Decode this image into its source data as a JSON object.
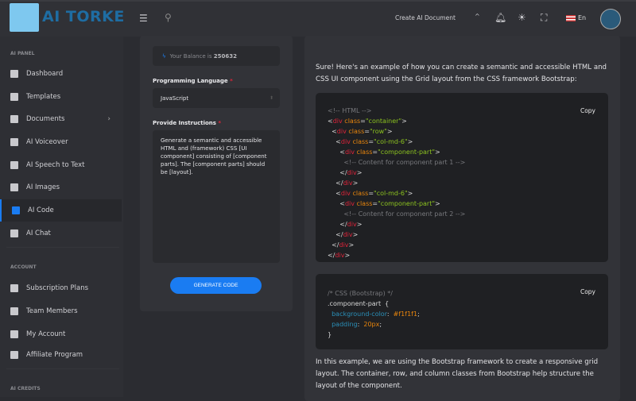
{
  "header": {
    "brand": "AI TORKE",
    "create_label": "Create AI Document",
    "lang": "En",
    "icons": [
      "menu-icon",
      "search-icon",
      "chevron-up-icon",
      "bell-icon",
      "sun-icon",
      "fullscreen-icon",
      "us-flag-icon",
      "avatar"
    ]
  },
  "sidebar": {
    "sections": [
      "AI PANEL",
      "ACCOUNT",
      "AI CREDITS"
    ],
    "items": [
      {
        "label": "Dashboard",
        "icon": "dashboard-icon"
      },
      {
        "label": "Templates",
        "icon": "templates-icon"
      },
      {
        "label": "Documents",
        "icon": "folder-icon"
      },
      {
        "label": "AI Voiceover",
        "icon": "waveform-icon"
      },
      {
        "label": "AI Speech to Text",
        "icon": "audio-file-icon"
      },
      {
        "label": "AI Images",
        "icon": "image-icon"
      },
      {
        "label": "AI Code",
        "icon": "code-icon"
      },
      {
        "label": "AI Chat",
        "icon": "chat-icon"
      },
      {
        "label": "Subscription Plans",
        "icon": "plans-icon"
      },
      {
        "label": "Team Members",
        "icon": "team-icon"
      },
      {
        "label": "My Account",
        "icon": "account-icon"
      },
      {
        "label": "Affiliate Program",
        "icon": "dollar-icon"
      }
    ]
  },
  "form": {
    "balance_prefix": "Your Balance is",
    "balance": "250632",
    "language_label": "Programming Language",
    "language_value": "JavaScript",
    "instructions_label": "Provide Instructions",
    "instructions_value": "Generate a semantic and accessible HTML and (framework) CSS [UI component] consisting of [component parts]. The [component parts] should be [layout].",
    "generate_label": "GENERATE CODE"
  },
  "result": {
    "intro": "Sure! Here's an example of how you can create a semantic and accessible HTML and CSS UI component using the Grid layout from the CSS framework Bootstrap:",
    "copy_label": "Copy",
    "html_code": [
      [
        [
          "c",
          "<!-- HTML -->"
        ]
      ],
      [
        [
          "p",
          "<"
        ],
        [
          "tag",
          "div"
        ],
        [
          "attr",
          " class"
        ],
        [
          "p",
          "="
        ],
        [
          "str",
          "\"container\""
        ],
        [
          "p",
          ">"
        ]
      ],
      [
        [
          "p",
          "  <"
        ],
        [
          "tag",
          "div"
        ],
        [
          "attr",
          " class"
        ],
        [
          "p",
          "="
        ],
        [
          "str",
          "\"row\""
        ],
        [
          "p",
          ">"
        ]
      ],
      [
        [
          "p",
          "    <"
        ],
        [
          "tag",
          "div"
        ],
        [
          "attr",
          " class"
        ],
        [
          "p",
          "="
        ],
        [
          "str",
          "\"col-md-6\""
        ],
        [
          "p",
          ">"
        ]
      ],
      [
        [
          "p",
          "      <"
        ],
        [
          "tag",
          "div"
        ],
        [
          "attr",
          " class"
        ],
        [
          "p",
          "="
        ],
        [
          "str",
          "\"component-part\""
        ],
        [
          "p",
          ">"
        ]
      ],
      [
        [
          "c",
          "        <!-- Content for component part 1 -->"
        ]
      ],
      [
        [
          "p",
          "      </"
        ],
        [
          "tag",
          "div"
        ],
        [
          "p",
          ">"
        ]
      ],
      [
        [
          "p",
          "    </"
        ],
        [
          "tag",
          "div"
        ],
        [
          "p",
          ">"
        ]
      ],
      [
        [
          "p",
          "    <"
        ],
        [
          "tag",
          "div"
        ],
        [
          "attr",
          " class"
        ],
        [
          "p",
          "="
        ],
        [
          "str",
          "\"col-md-6\""
        ],
        [
          "p",
          ">"
        ]
      ],
      [
        [
          "p",
          "      <"
        ],
        [
          "tag",
          "div"
        ],
        [
          "attr",
          " class"
        ],
        [
          "p",
          "="
        ],
        [
          "str",
          "\"component-part\""
        ],
        [
          "p",
          ">"
        ]
      ],
      [
        [
          "c",
          "        <!-- Content for component part 2 -->"
        ]
      ],
      [
        [
          "p",
          "      </"
        ],
        [
          "tag",
          "div"
        ],
        [
          "p",
          ">"
        ]
      ],
      [
        [
          "p",
          "    </"
        ],
        [
          "tag",
          "div"
        ],
        [
          "p",
          ">"
        ]
      ],
      [
        [
          "p",
          "  </"
        ],
        [
          "tag",
          "div"
        ],
        [
          "p",
          ">"
        ]
      ],
      [
        [
          "p",
          "</"
        ],
        [
          "tag",
          "div"
        ],
        [
          "p",
          ">"
        ]
      ]
    ],
    "css_code": [
      [
        [
          "c",
          "/* CSS (Bootstrap) */"
        ]
      ],
      [
        [
          "p",
          ".component-part  {"
        ]
      ],
      [
        [
          "prop",
          "  background-color"
        ],
        [
          "p",
          ":  "
        ],
        [
          "val",
          "#f1f1f1"
        ],
        [
          "p",
          ";"
        ]
      ],
      [
        [
          "prop",
          "  padding"
        ],
        [
          "p",
          ":  "
        ],
        [
          "val",
          "20px"
        ],
        [
          "p",
          ";"
        ]
      ],
      [
        [
          "p",
          "}"
        ]
      ]
    ],
    "outro": "In this example, we are using the Bootstrap framework to create a responsive grid layout. The container, row, and column classes from Bootstrap help structure the layout of the component."
  }
}
